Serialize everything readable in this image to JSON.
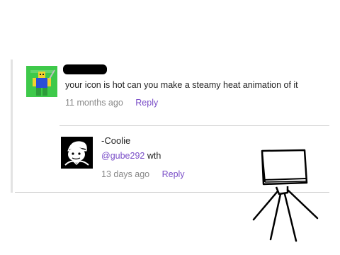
{
  "comment": {
    "author_redacted": true,
    "text": "your icon is hot can you make a steamy heat animation of it",
    "timestamp": "11 months ago",
    "reply_label": "Reply",
    "avatar": "roblox-character-avatar"
  },
  "reply": {
    "author": "-Coolie",
    "mention": "@gube292",
    "text": " wth",
    "timestamp": "13 days ago",
    "reply_label": "Reply",
    "avatar": "cartoon-face-avatar"
  },
  "colors": {
    "link": "#7b4fc8",
    "meta": "#888888",
    "text": "#222222",
    "thread_bar": "#e3e3e3"
  },
  "drawing": "stick-figure-box-head-doodle"
}
